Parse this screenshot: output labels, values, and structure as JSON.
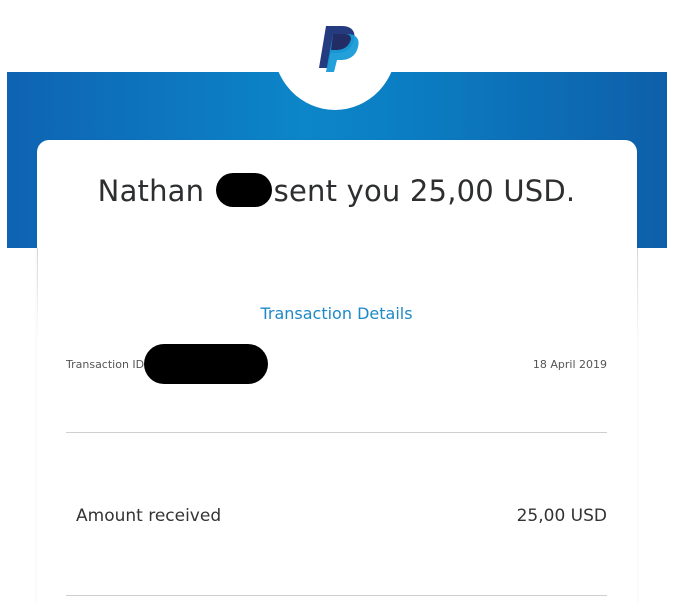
{
  "brand": {
    "logo_icon": "paypal-logo-icon",
    "primary_color": "#253b80",
    "secondary_color": "#179bd7",
    "banner_color": "#0c86c8"
  },
  "message": {
    "name_prefix": "Nathan",
    "text_suffix": "sent you 25,00 USD."
  },
  "details": {
    "link_label": "Transaction Details",
    "transaction_id_label": "Transaction ID:",
    "date": "18 April 2019"
  },
  "amount": {
    "label": "Amount received",
    "value": "25,00 USD"
  }
}
